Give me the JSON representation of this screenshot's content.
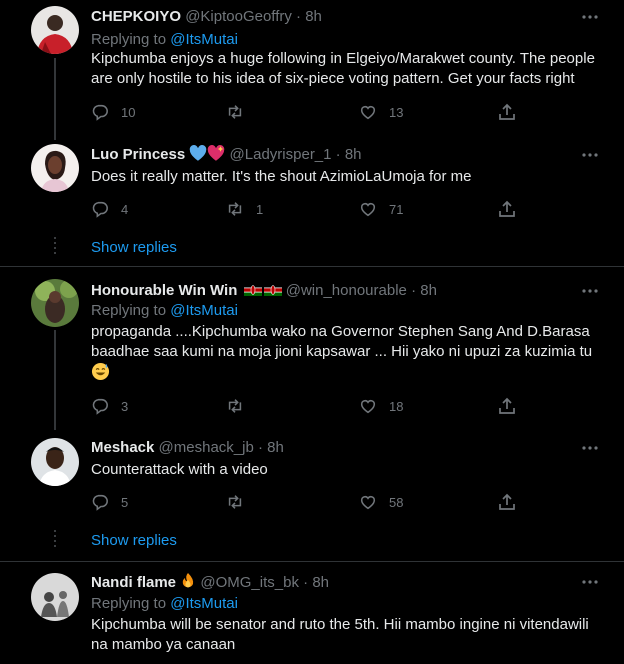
{
  "tweets": [
    {
      "name": "CHEPKOIYO",
      "handle": "@KiptooGeoffry",
      "time": "8h",
      "replying_label": "Replying to",
      "replying_to": "@ItsMutai",
      "text": "Kipchumba enjoys a huge following in Elgeiyo/Marakwet county. The people are only hostile to his idea of six-piece voting pattern. Get your facts right",
      "replies": "10",
      "retweets": "",
      "likes": "13"
    },
    {
      "name": "Luo Princess",
      "name_emojis": [
        "blue-heart",
        "sparkling-heart"
      ],
      "handle": "@Ladyrisper_1",
      "time": "8h",
      "text": "Does it really matter. It's the shout AzimioLaUmoja for me",
      "replies": "4",
      "retweets": "1",
      "likes": "71"
    },
    {
      "name": "Honourable Win Win",
      "name_emojis": [
        "kenya-flag",
        "kenya-flag"
      ],
      "handle": "@win_honourable",
      "time": "8h",
      "replying_label": "Replying to",
      "replying_to": "@ItsMutai",
      "text": "propaganda ....Kipchumba wako na Governor Stephen Sang And D.Barasa baadhae saa kumi na moja jioni kapsawar ... Hii yako ni upuzi za kuzimia tu",
      "text_emoji": "grinning-sweat-face",
      "replies": "3",
      "retweets": "",
      "likes": "18"
    },
    {
      "name": "Meshack",
      "handle": "@meshack_jb",
      "time": "8h",
      "text": "Counterattack with a video",
      "replies": "5",
      "retweets": "",
      "likes": "58"
    },
    {
      "name": "Nandi flame",
      "name_emojis": [
        "fire"
      ],
      "handle": "@OMG_its_bk",
      "time": "8h",
      "replying_label": "Replying to",
      "replying_to": "@ItsMutai",
      "text": "Kipchumba will be senator and ruto the 5th. Hii mambo ingine ni vitendawili na mambo ya canaan"
    }
  ],
  "show_replies": "Show replies",
  "separator": "·",
  "colors": {
    "background": "#000000",
    "text": "#e7e9ea",
    "muted": "#71767b",
    "link": "#1d9bf0",
    "divider": "#2f3336"
  }
}
